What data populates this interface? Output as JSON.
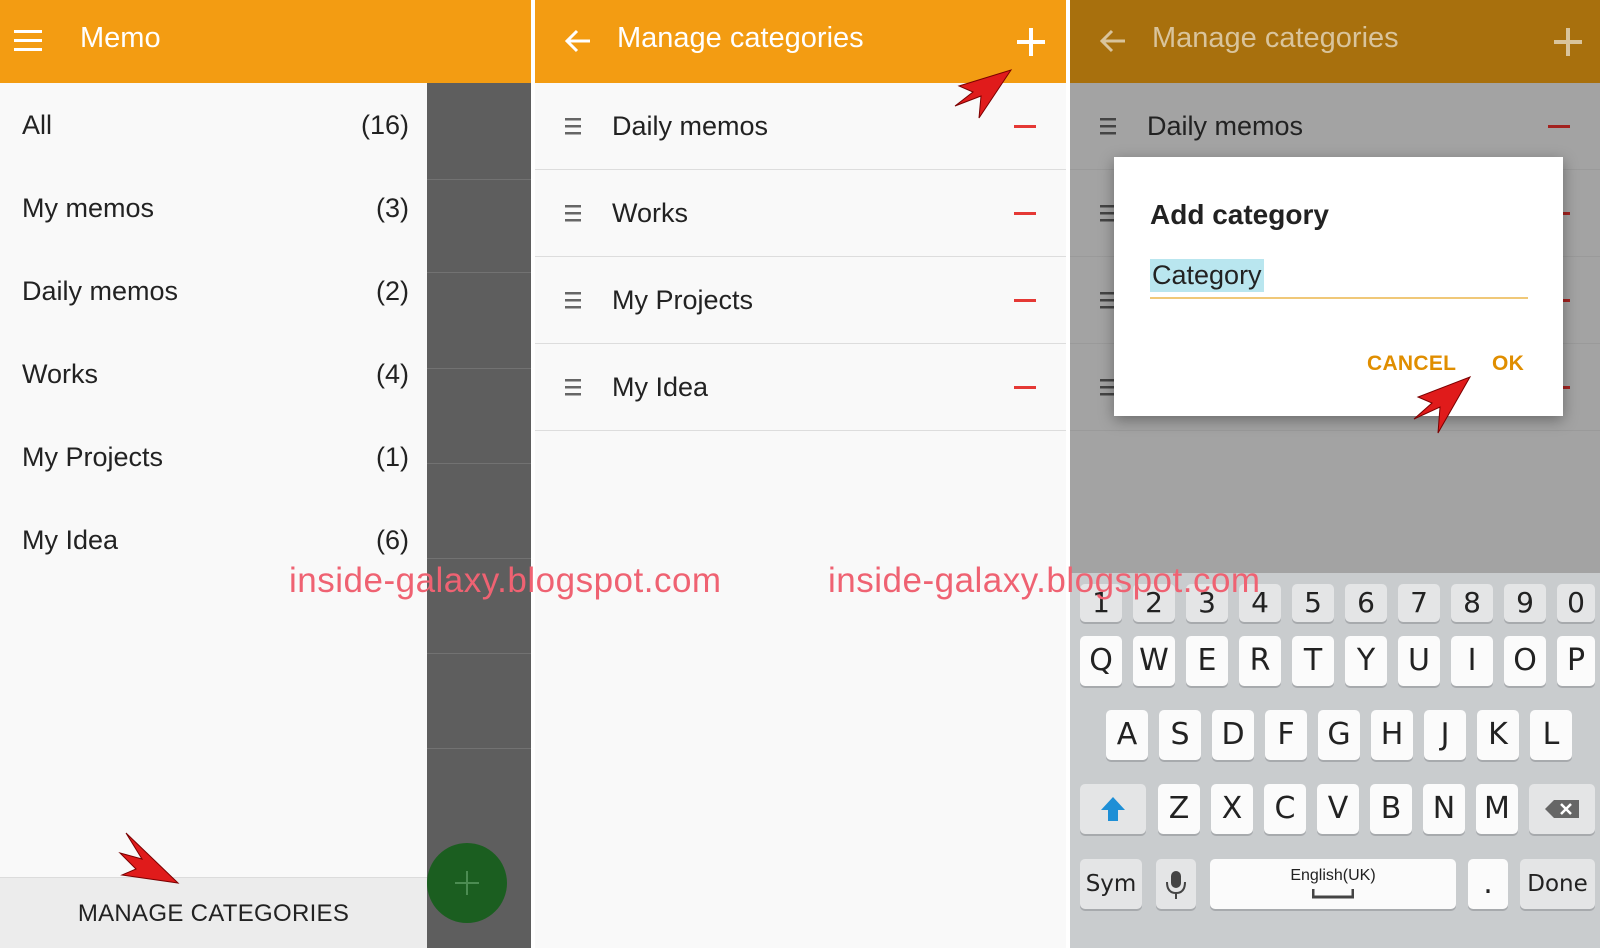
{
  "memo_screen": {
    "title": "Memo",
    "categories": [
      {
        "name": "All",
        "count": "(16)"
      },
      {
        "name": "My memos",
        "count": "(3)"
      },
      {
        "name": "Daily memos",
        "count": "(2)"
      },
      {
        "name": "Works",
        "count": "(4)"
      },
      {
        "name": "My Projects",
        "count": "(1)"
      },
      {
        "name": "My Idea",
        "count": "(6)"
      }
    ],
    "manage_label": "MANAGE CATEGORIES"
  },
  "manage_screen": {
    "title": "Manage categories",
    "items": [
      "Daily memos",
      "Works",
      "My Projects",
      "My Idea"
    ]
  },
  "dialog_screen": {
    "title": "Manage categories",
    "first_item": "Daily memos",
    "dialog": {
      "title": "Add category",
      "input_value": "Category",
      "cancel_label": "CANCEL",
      "ok_label": "OK"
    },
    "keyboard": {
      "number_row": [
        "1",
        "2",
        "3",
        "4",
        "5",
        "6",
        "7",
        "8",
        "9",
        "0"
      ],
      "row1": [
        "Q",
        "W",
        "E",
        "R",
        "T",
        "Y",
        "U",
        "I",
        "O",
        "P"
      ],
      "row2": [
        "A",
        "S",
        "D",
        "F",
        "G",
        "H",
        "J",
        "K",
        "L"
      ],
      "row3": [
        "Z",
        "X",
        "C",
        "V",
        "B",
        "N",
        "M"
      ],
      "sym_label": "Sym",
      "space_label": "English(UK)",
      "period_label": ".",
      "done_label": "Done"
    }
  },
  "watermark": "inside-galaxy.blogspot.com",
  "colors": {
    "app_bar": "#f39c12",
    "app_bar_dimmed": "#a8700d",
    "delete_minus": "#e53935",
    "dialog_button": "#e08e00",
    "fab": "#1b5e20",
    "watermark": "#ef6272"
  }
}
